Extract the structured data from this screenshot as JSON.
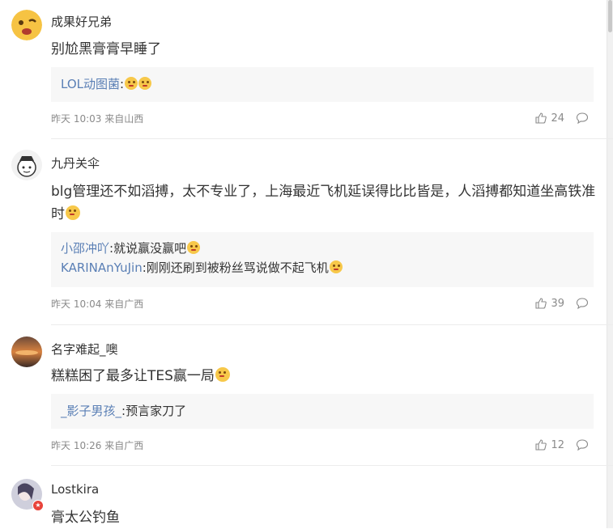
{
  "comments": [
    {
      "user": "成果好兄弟",
      "text": "别尬黑膏膏早睡了",
      "replies": [
        {
          "user": "LOL动图菌",
          "text": ":"
        }
      ],
      "time": "昨天 10:03 来自山西",
      "likes": "24",
      "avatar_color": "#f6c343"
    },
    {
      "user": "九丹关伞",
      "text": "blg管理还不如滔搏，太不专业了，上海最近飞机延误得比比皆是，人滔搏都知道坐高铁准时",
      "replies": [
        {
          "user": "小邵冲吖",
          "text": ":就说赢没赢吧"
        },
        {
          "user": "KARINAnYuJin",
          "text": ":刚刚还刷到被粉丝骂说做不起飞机"
        }
      ],
      "time": "昨天 10:04 来自广西",
      "likes": "39",
      "avatar_color": "#e9e9e9"
    },
    {
      "user": "名字难起_噢",
      "text": "糕糕困了最多让TES赢一局",
      "replies": [
        {
          "user": "_影子男孩_",
          "text": ":预言家刀了"
        }
      ],
      "time": "昨天 10:26 来自广西",
      "likes": "12",
      "avatar_color": "#b9603a"
    },
    {
      "user": "Lostkira",
      "text": "膏太公钓鱼",
      "replies": [],
      "time": "",
      "likes": "",
      "avatar_color": "#8a8aa8"
    }
  ]
}
